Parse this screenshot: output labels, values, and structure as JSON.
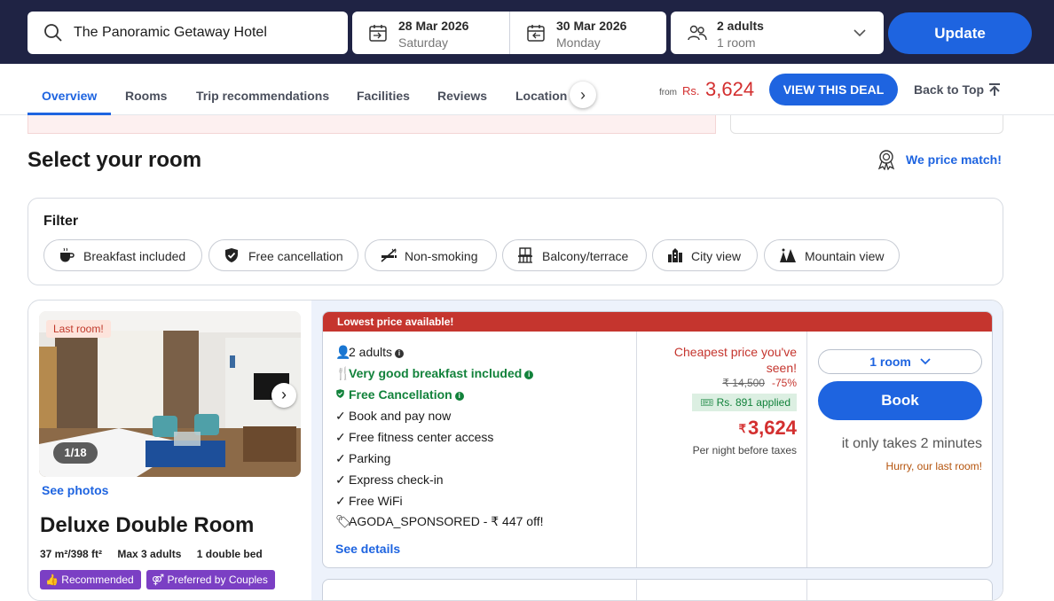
{
  "search": {
    "hotel": "The Panoramic Getaway Hotel",
    "checkin_date": "28 Mar 2026",
    "checkin_day": "Saturday",
    "checkout_date": "30 Mar 2026",
    "checkout_day": "Monday",
    "guests": "2 adults",
    "rooms": "1 room",
    "update_label": "Update"
  },
  "nav": {
    "tabs": [
      {
        "label": "Overview",
        "active": true
      },
      {
        "label": "Rooms"
      },
      {
        "label": "Trip recommendations"
      },
      {
        "label": "Facilities"
      },
      {
        "label": "Reviews"
      },
      {
        "label": "Location"
      }
    ],
    "arrow": "›",
    "from_label": "from",
    "currency": "Rs.",
    "price": "3,624",
    "deal_label": "VIEW THIS DEAL",
    "back_to_top": "Back to Top"
  },
  "select_room": {
    "title": "Select your room",
    "price_match": "We price match!"
  },
  "filter": {
    "title": "Filter",
    "chips": [
      {
        "label": "Breakfast included",
        "icon": "coffee-cup-icon"
      },
      {
        "label": "Free cancellation",
        "icon": "shield-check-icon"
      },
      {
        "label": "Non-smoking",
        "icon": "no-smoking-icon"
      },
      {
        "label": "Balcony/terrace",
        "icon": "balcony-icon"
      },
      {
        "label": "City view",
        "icon": "city-icon"
      },
      {
        "label": "Mountain view",
        "icon": "mountain-icon"
      }
    ]
  },
  "room": {
    "last_room": "Last room!",
    "photo_count": "1/18",
    "see_photos": "See photos",
    "name": "Deluxe Double Room",
    "size": "37 m²/398 ft²",
    "max": "Max 3 adults",
    "bed": "1 double bed",
    "badges": [
      "Recommended",
      "Preferred by Couples"
    ]
  },
  "offer": {
    "header": "Lowest price available!",
    "features": [
      {
        "text": "2 adults",
        "green": false
      },
      {
        "text": "Very good breakfast included",
        "green": true
      },
      {
        "text": "Free Cancellation",
        "green": true
      },
      {
        "text": "Book and pay now",
        "green": false
      },
      {
        "text": "Free fitness center access",
        "green": false
      },
      {
        "text": "Parking",
        "green": false
      },
      {
        "text": "Express check-in",
        "green": false
      },
      {
        "text": "Free WiFi",
        "green": false
      },
      {
        "text": "AGODA_SPONSORED - ₹ 447 off!",
        "green": false
      }
    ],
    "see_details": "See details",
    "cheapest": "Cheapest price you've seen!",
    "original_price": "₹ 14,500",
    "discount": "-75%",
    "applied": "Rs. 891 applied",
    "currency_symbol": "₹",
    "final_price": "3,624",
    "per_night": "Per night before taxes",
    "room_select": "1 room",
    "book_label": "Book",
    "takes": "it only takes 2 minutes",
    "hurry": "Hurry, our last room!"
  },
  "colors": {
    "topbar": "#1f2344",
    "accent": "#1e64e0",
    "price_red": "#d32f2f",
    "green": "#12823b",
    "badge_purple": "#7b3fc4"
  }
}
